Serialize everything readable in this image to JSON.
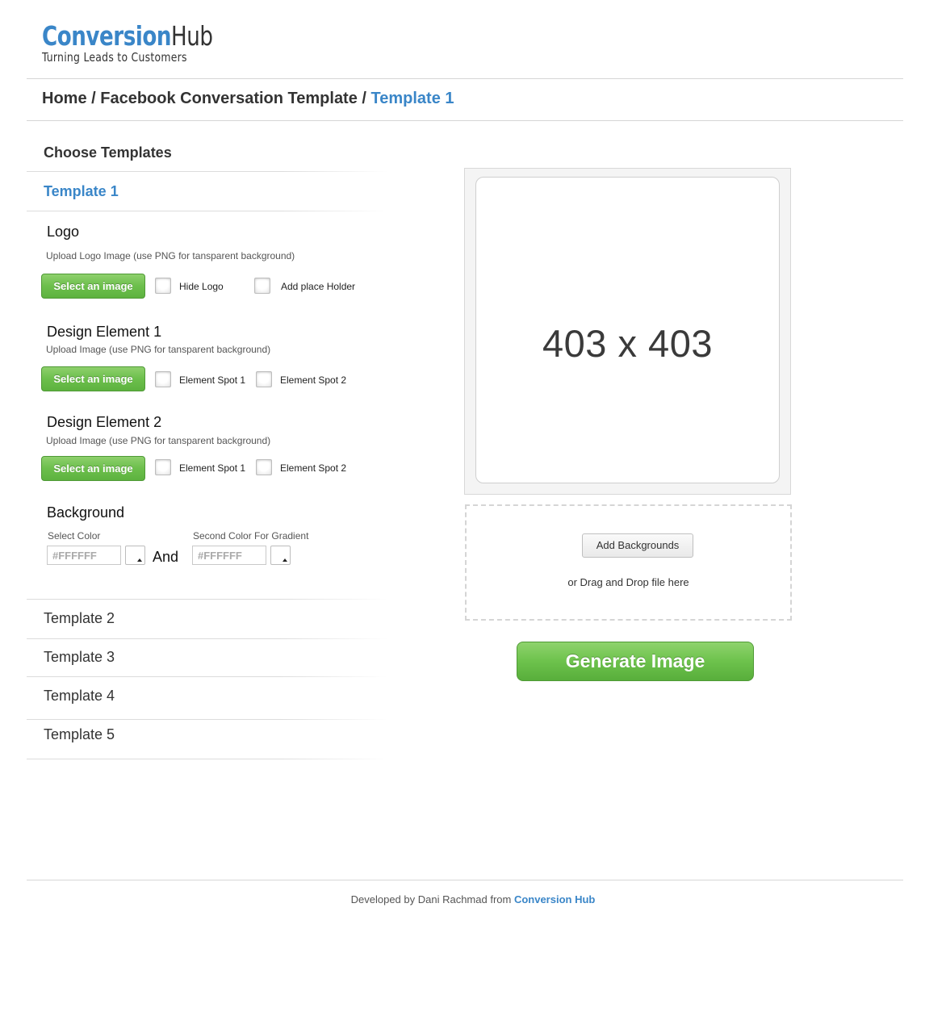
{
  "logo": {
    "brand_part1": "Conversion",
    "brand_part2": "Hub",
    "tagline": "Turning Leads to Customers"
  },
  "breadcrumb": {
    "home": "Home",
    "sep1": " / ",
    "parent": "Facebook Conversation Template",
    "sep2": " / ",
    "current": "Template 1"
  },
  "sidebar": {
    "title": "Choose Templates",
    "active_template": "Template 1",
    "logo_group": {
      "title": "Logo",
      "hint": "Upload Logo Image (use PNG for tansparent background)",
      "button": "Select an image",
      "option1": "Hide Logo",
      "option2": "Add place Holder"
    },
    "design1": {
      "title": "Design Element 1",
      "hint": "Upload Image (use PNG for tansparent background)",
      "button": "Select an image",
      "option1": "Element Spot 1",
      "option2": "Element Spot 2"
    },
    "design2": {
      "title": "Design Element 2",
      "hint": "Upload Image (use PNG for tansparent background)",
      "button": "Select an image",
      "option1": "Element Spot 1",
      "option2": "Element Spot 2"
    },
    "background": {
      "title": "Background",
      "label1": "Select Color",
      "value1": "#FFFFFF",
      "and": "And",
      "label2": "Second Color For Gradient",
      "value2": "#FFFFFF"
    },
    "templates": [
      "Template 2",
      "Template 3",
      "Template 4",
      "Template 5"
    ]
  },
  "preview": {
    "size_text": "403 x 403"
  },
  "dropzone": {
    "button": "Add Backgrounds",
    "text": "or Drag and Drop file here"
  },
  "generate": {
    "label": "Generate Image"
  },
  "footer": {
    "prefix": "Developed by Dani Rachmad from ",
    "link": "Conversion Hub"
  },
  "colors": {
    "accent": "#3a86c8",
    "green": "#6cbf4c"
  }
}
